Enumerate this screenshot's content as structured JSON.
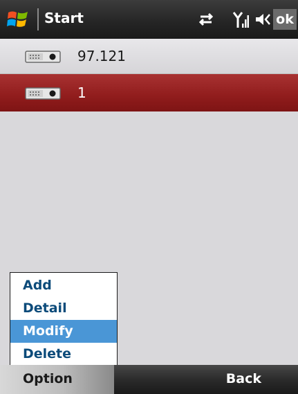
{
  "titlebar": {
    "title": "Start",
    "ok_label": "ok",
    "icons": [
      "windows-flag-icon",
      "connectivity-arrows-icon",
      "signal-strength-icon",
      "speaker-volume-icon"
    ]
  },
  "list": {
    "items": [
      {
        "label": "97.121",
        "icon": "network-device-icon",
        "selected": false
      },
      {
        "label": "1",
        "icon": "network-device-icon",
        "selected": true
      }
    ]
  },
  "menu": {
    "items": [
      {
        "label": "Add",
        "active": false
      },
      {
        "label": "Detail",
        "active": false
      },
      {
        "label": "Modify",
        "active": true
      },
      {
        "label": "Delete",
        "active": false
      }
    ]
  },
  "softkeys": {
    "left": "Option",
    "right": "Back"
  },
  "colors": {
    "selected_row": "#901c1c",
    "menu_highlight": "#4a96d6",
    "menu_text": "#0c4b7a",
    "background": "#d9d8db"
  }
}
